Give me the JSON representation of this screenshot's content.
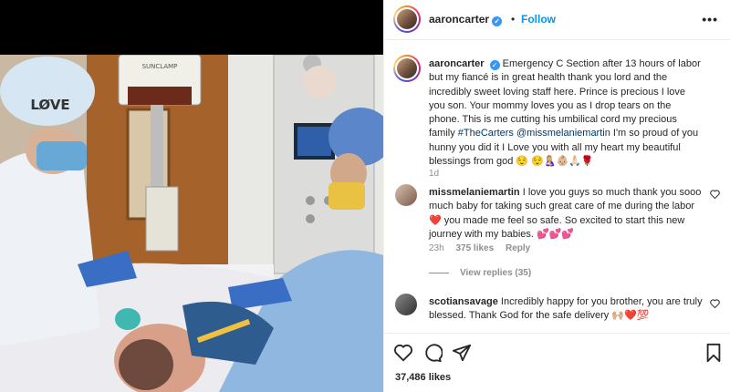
{
  "post": {
    "username": "aaroncarter",
    "verified_glyph": "✓",
    "dot": "•",
    "follow_label": "Follow",
    "more_icon": "•••",
    "likes": "37,486 likes"
  },
  "caption": {
    "username": "aaroncarter",
    "text_before_tag": "Emergency C Section after 13 hours of labor but my fiancé is in great health thank you lord and the incredibly sweet loving staff here. Prince is precious I love you son. Your mommy loves you as I drop tears on the phone. This is me cutting his umbilical cord my precious family ",
    "hashtag": "#TheCarters",
    "mention": "@missmelaniemartin",
    "text_after_tag": " I'm so proud of you hunny you did it I Love you with all my heart my beautiful blessings from god 😌 😌🤱🏼👶🏼🙏🏻🌹",
    "age": "1d"
  },
  "comments": [
    {
      "username": "missmelaniemartin",
      "text": "I love you guys so much thank you sooo much baby for taking such great care of me during the labor ❤️ you made me feel so safe. So excited to start this new journey with my babies. 💕💕💕",
      "age": "23h",
      "likes": "375 likes",
      "reply": "Reply",
      "view_replies": "View replies (35)"
    },
    {
      "username": "scotiansavage",
      "text": "Incredibly happy for you brother, you are truly blessed. Thank God for the safe delivery 🙌🏼❤️💯"
    }
  ],
  "photo_text": {
    "cap_word": "LØVE",
    "lamp_brand": "SUNCLAMP"
  },
  "colors": {
    "accent": "#0095f6",
    "verified": "#3897f0",
    "hashtag": "#00376b",
    "muted": "#8e8e8e"
  },
  "icons": [
    "heart-icon",
    "comment-icon",
    "share-icon",
    "save-icon",
    "more-icon",
    "verified-icon"
  ]
}
